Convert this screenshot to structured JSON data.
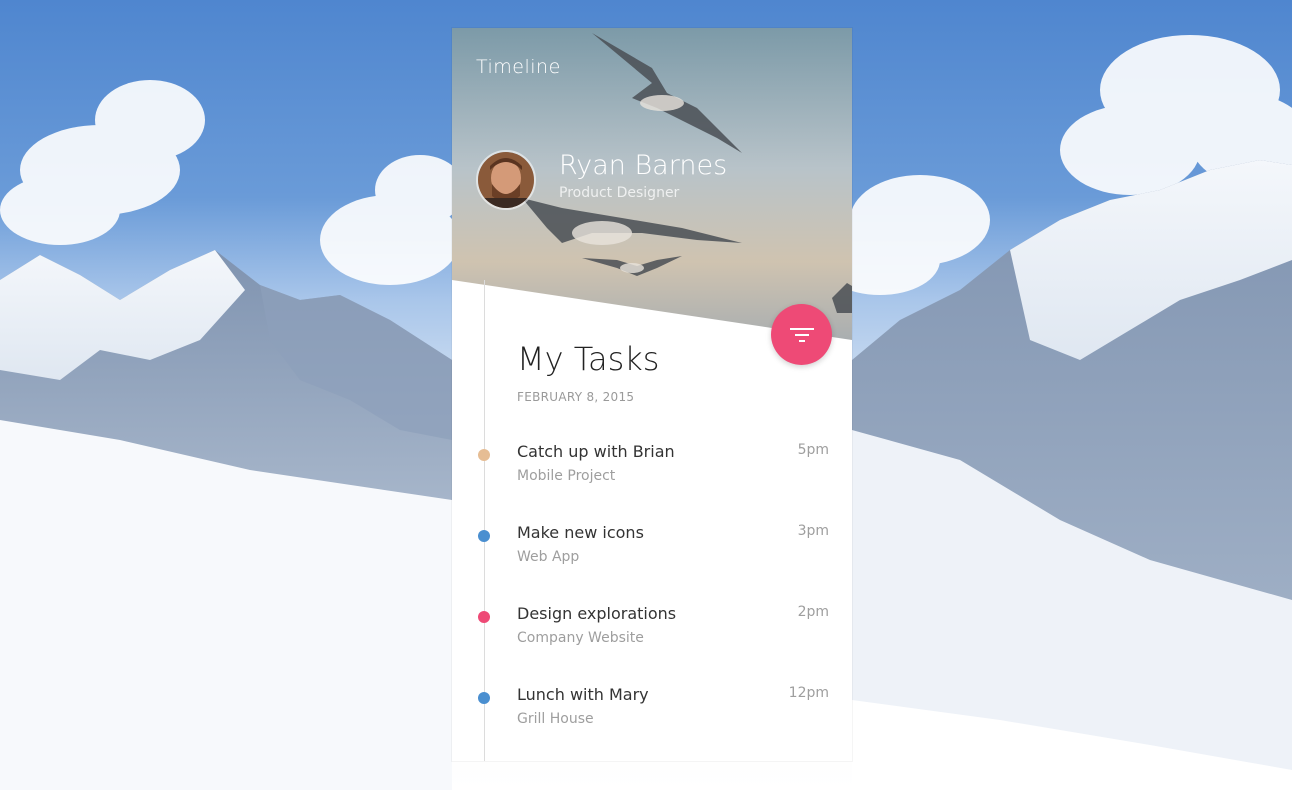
{
  "header": {
    "title": "Timeline"
  },
  "profile": {
    "name": "Ryan Barnes",
    "role": "Product Designer"
  },
  "tasks_section": {
    "title": "My Tasks",
    "date": "FEBRUARY 8, 2015"
  },
  "actions": {
    "filter_icon": "filter-icon",
    "filter_color": "#ee4a76"
  },
  "tasks": [
    {
      "name": "Catch up with Brian",
      "subtitle": "Mobile Project",
      "time": "5pm",
      "color": "#e6bd94"
    },
    {
      "name": "Make new icons",
      "subtitle": "Web App",
      "time": "3pm",
      "color": "#4a8fd0"
    },
    {
      "name": "Design explorations",
      "subtitle": "Company Website",
      "time": "2pm",
      "color": "#ee4a76"
    },
    {
      "name": "Lunch with Mary",
      "subtitle": "Grill House",
      "time": "12pm",
      "color": "#4a8fd0"
    }
  ]
}
